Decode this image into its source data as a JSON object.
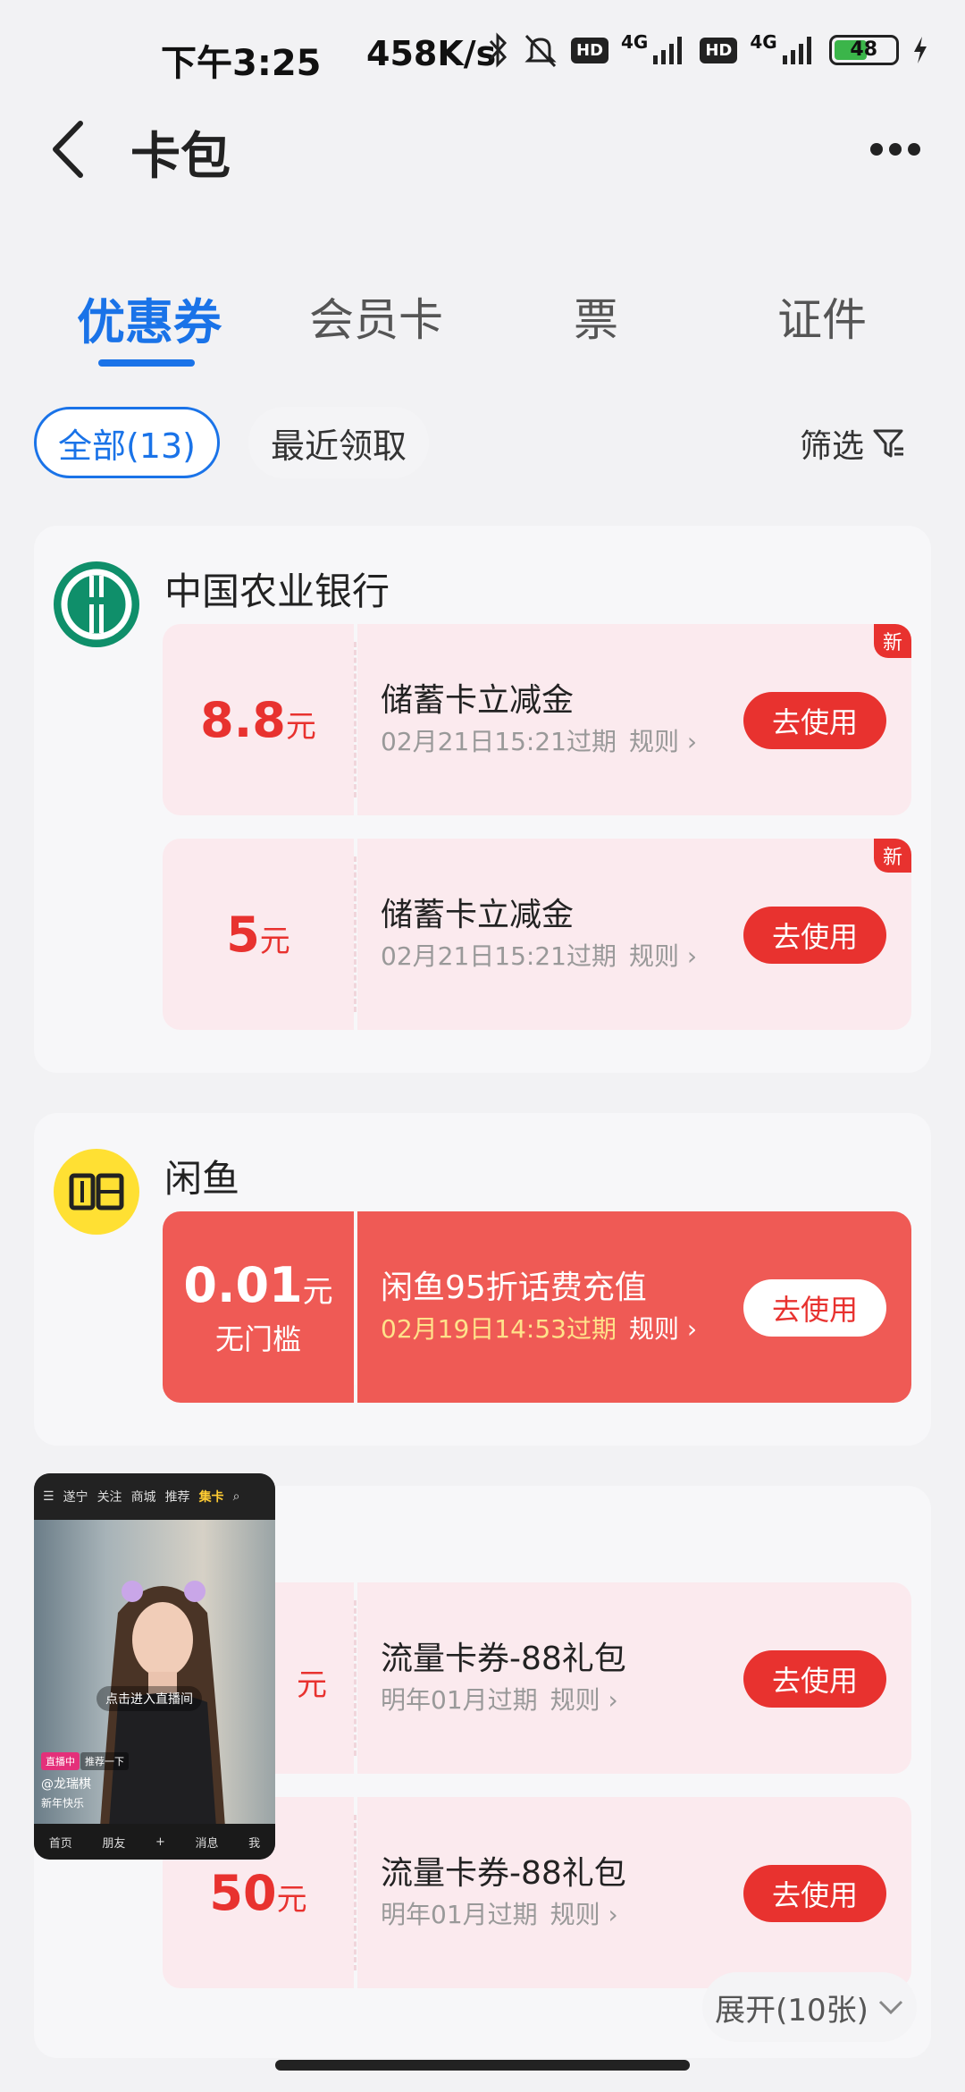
{
  "status": {
    "time": "下午3:25",
    "speed": "458K/s",
    "network1": "4G",
    "network2": "4G",
    "hd": "HD",
    "battery": "48",
    "battery_level": 0.48
  },
  "header": {
    "title": "卡包"
  },
  "tabs": [
    {
      "label": "优惠券",
      "active": true
    },
    {
      "label": "会员卡"
    },
    {
      "label": "票"
    },
    {
      "label": "证件"
    }
  ],
  "filters": {
    "all": "全部(13)",
    "recent": "最近领取",
    "filter": "筛选"
  },
  "groups": [
    {
      "brand": "中国农业银行",
      "coupons": [
        {
          "amount": "8.8",
          "unit": "元",
          "title": "储蓄卡立减金",
          "expiry": "02月21日15:21过期",
          "rule": "规则",
          "button": "去使用",
          "badge": "新"
        },
        {
          "amount": "5",
          "unit": "元",
          "title": "储蓄卡立减金",
          "expiry": "02月21日15:21过期",
          "rule": "规则",
          "button": "去使用",
          "badge": "新"
        }
      ]
    },
    {
      "brand": "闲鱼",
      "coupons": [
        {
          "amount": "0.01",
          "unit": "元",
          "threshold": "无门槛",
          "title": "闲鱼95折话费充值",
          "expiry": "02月19日14:53过期",
          "rule": "规则",
          "button": "去使用"
        }
      ]
    },
    {
      "brand": "",
      "coupons": [
        {
          "amount": "",
          "unit": "元",
          "title": "流量卡券-88礼包",
          "expiry": "明年01月过期",
          "rule": "规则",
          "button": "去使用"
        },
        {
          "amount": "50",
          "unit": "元",
          "title": "流量卡券-88礼包",
          "expiry": "明年01月过期",
          "rule": "规则",
          "button": "去使用"
        }
      ]
    }
  ],
  "pip": {
    "tabs": [
      "遂宁",
      "关注",
      "商城",
      "推荐",
      "集卡"
    ],
    "live_hint": "点击进入直播间",
    "live_tag": "直播中",
    "recommend": "推荐一下",
    "user": "@龙瑞棋",
    "greeting": "新年快乐",
    "bottom": [
      "首页",
      "朋友",
      "+",
      "消息",
      "我"
    ]
  },
  "expand": "展开(10张)",
  "colors": {
    "accent": "#1a73e8",
    "coupon_red": "#e8322f",
    "abc_green": "#0f8f6a",
    "xianyu_yellow": "#ffe033"
  }
}
